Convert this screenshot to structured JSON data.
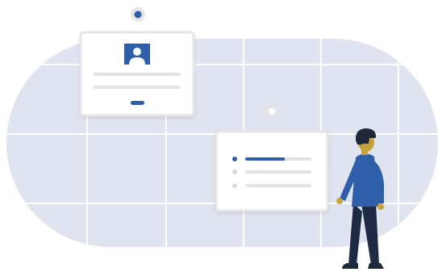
{
  "colors": {
    "background": "#ffffff",
    "blob": "#e0e4f0",
    "grid_line": "#ffffff",
    "card": "#ffffff",
    "card_border": "#e6e6e6",
    "accent": "#2f5fa8",
    "muted_line": "#e3e3e3",
    "muted_dot": "#d9d9d9",
    "pin_outer": "#e6e6e6",
    "skin": "#c8a23a",
    "hair": "#1e2a3a",
    "shirt": "#2f5fa8",
    "pants": "#1f2a44",
    "shoes": "#1e2a3a"
  },
  "icons": {
    "profile_card_pin": "pin-icon",
    "profile_avatar": "user-avatar-icon",
    "list_card_pin": "pin-icon",
    "person": "person-illustration"
  },
  "list_card": {
    "active_item_progress": 0.6
  }
}
